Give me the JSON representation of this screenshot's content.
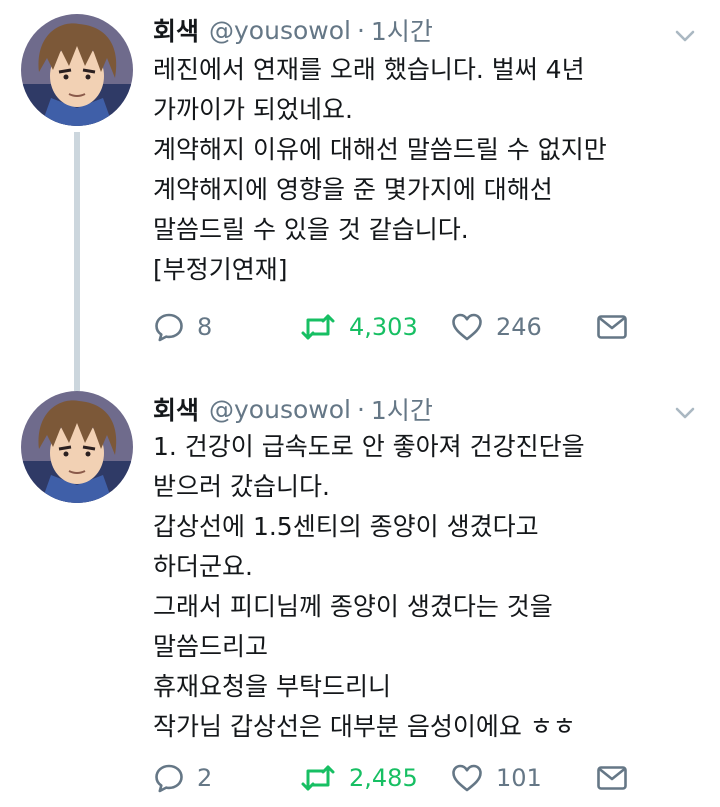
{
  "tweets": [
    {
      "name": "회색",
      "handle": "@yousowol",
      "separator": "·",
      "time": "1시간",
      "lines": [
        "레진에서 연재를 오래 했습니다.  벌써 4년",
        "가까이가 되었네요.",
        "계약해지 이유에 대해선 말씀드릴 수 없지만",
        "계약해지에 영향을 준 몇가지에 대해선",
        "말씀드릴 수 있을 것 같습니다.",
        "[부정기연재]"
      ],
      "replies": "8",
      "retweets": "4,303",
      "likes": "246"
    },
    {
      "name": "회색",
      "handle": "@yousowol",
      "separator": "·",
      "time": "1시간",
      "lines": [
        "1. 건강이 급속도로 안 좋아져 건강진단을",
        "받으러 갔습니다.",
        "갑상선에 1.5센티의 종양이 생겼다고",
        "하더군요.",
        "그래서 피디님께 종양이 생겼다는 것을",
        "말씀드리고",
        "휴재요청을 부탁드리니",
        "작가님 갑상선은 대부분 음성이에요 ㅎㅎ"
      ],
      "replies": "2",
      "retweets": "2,485",
      "likes": "101"
    }
  ],
  "icons": {
    "reply": "reply-icon",
    "retweet": "retweet-icon",
    "like": "heart-icon",
    "dm": "envelope-icon",
    "menu": "chevron-down-icon"
  },
  "colors": {
    "text": "#14171a",
    "secondary": "#657786",
    "retweet_active": "#17bf63",
    "thread_line": "#ccd6dd"
  }
}
